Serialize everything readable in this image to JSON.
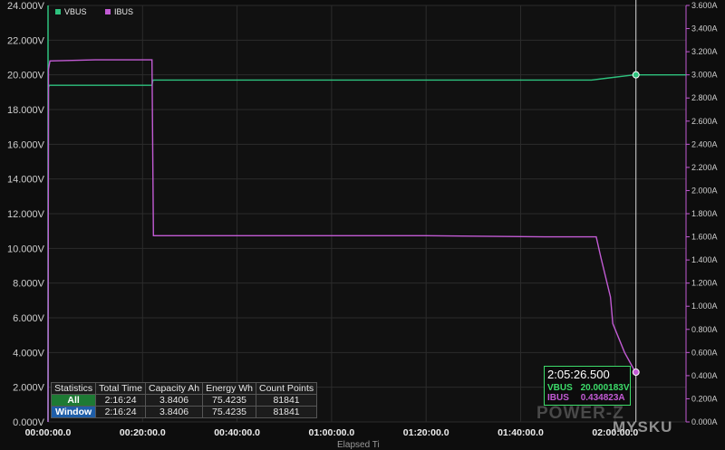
{
  "chart_data": {
    "type": "line",
    "xlabel": "Elapsed Ti",
    "x_ticks": [
      "00:00:00.0",
      "00:20:00.0",
      "00:40:00.0",
      "01:00:00.0",
      "01:20:00.0",
      "01:40:00.0",
      "02:00:00.0"
    ],
    "xlim_minutes": [
      0,
      135
    ],
    "y_left": {
      "ticks": [
        "0.000V",
        "2.000V",
        "4.000V",
        "6.000V",
        "8.000V",
        "10.000V",
        "12.000V",
        "14.000V",
        "16.000V",
        "18.000V",
        "20.000V",
        "22.000V",
        "24.000V"
      ],
      "ylim": [
        0,
        24
      ]
    },
    "y_right": {
      "ticks": [
        "0.000A",
        "0.200A",
        "0.400A",
        "0.600A",
        "0.800A",
        "1.000A",
        "1.200A",
        "1.400A",
        "1.600A",
        "1.800A",
        "2.000A",
        "2.200A",
        "2.400A",
        "2.600A",
        "2.800A",
        "3.000A",
        "3.200A",
        "3.400A",
        "3.600A"
      ],
      "ylim": [
        0,
        3.6
      ]
    },
    "series": [
      {
        "name": "VBUS",
        "axis": "left",
        "color": "#2ec27e",
        "x": [
          0,
          0.1,
          0.3,
          22,
          22.2,
          115,
          118,
          124,
          135
        ],
        "y": [
          0.1,
          19.3,
          19.4,
          19.4,
          19.7,
          19.7,
          19.8,
          20.0,
          20.0
        ]
      },
      {
        "name": "IBUS",
        "axis": "right",
        "color": "#c25bd4",
        "x": [
          0,
          0.1,
          0.4,
          10,
          22,
          22.3,
          40,
          80,
          105,
          116,
          117,
          119,
          119.5,
          122,
          124.3
        ],
        "y": [
          0.0,
          3.05,
          3.12,
          3.13,
          3.13,
          1.61,
          1.61,
          1.61,
          1.6,
          1.6,
          1.42,
          1.08,
          0.85,
          0.6,
          0.43
        ]
      }
    ],
    "legend": [
      "VBUS",
      "IBUS"
    ],
    "legend_position": "top-left",
    "grid": true,
    "cursor": {
      "x_minutes": 124.4,
      "time": "2:05:26.500",
      "vbus_label": "VBUS",
      "vbus_value": "20.000183V",
      "ibus_label": "IBUS",
      "ibus_value": "0.434823A"
    }
  },
  "statistics": {
    "headers": [
      "Statistics",
      "Total Time",
      "Capacity Ah",
      "Energy Wh",
      "Count Points"
    ],
    "rows": [
      {
        "label": "All",
        "label_color": "#1e7a34",
        "values": [
          "2:16:24",
          "3.8406",
          "75.4235",
          "81841"
        ]
      },
      {
        "label": "Window",
        "label_color": "#1f5ea8",
        "values": [
          "2:16:24",
          "3.8406",
          "75.4235",
          "81841"
        ]
      }
    ]
  },
  "watermark": {
    "primary": "POWER-Z",
    "secondary": "MYSKU"
  },
  "colors": {
    "background": "#0d0d0d",
    "grid": "#2c2c2c",
    "vbus": "#2ec27e",
    "ibus": "#c25bd4",
    "cursor_box_border": "#3ddc6a"
  }
}
